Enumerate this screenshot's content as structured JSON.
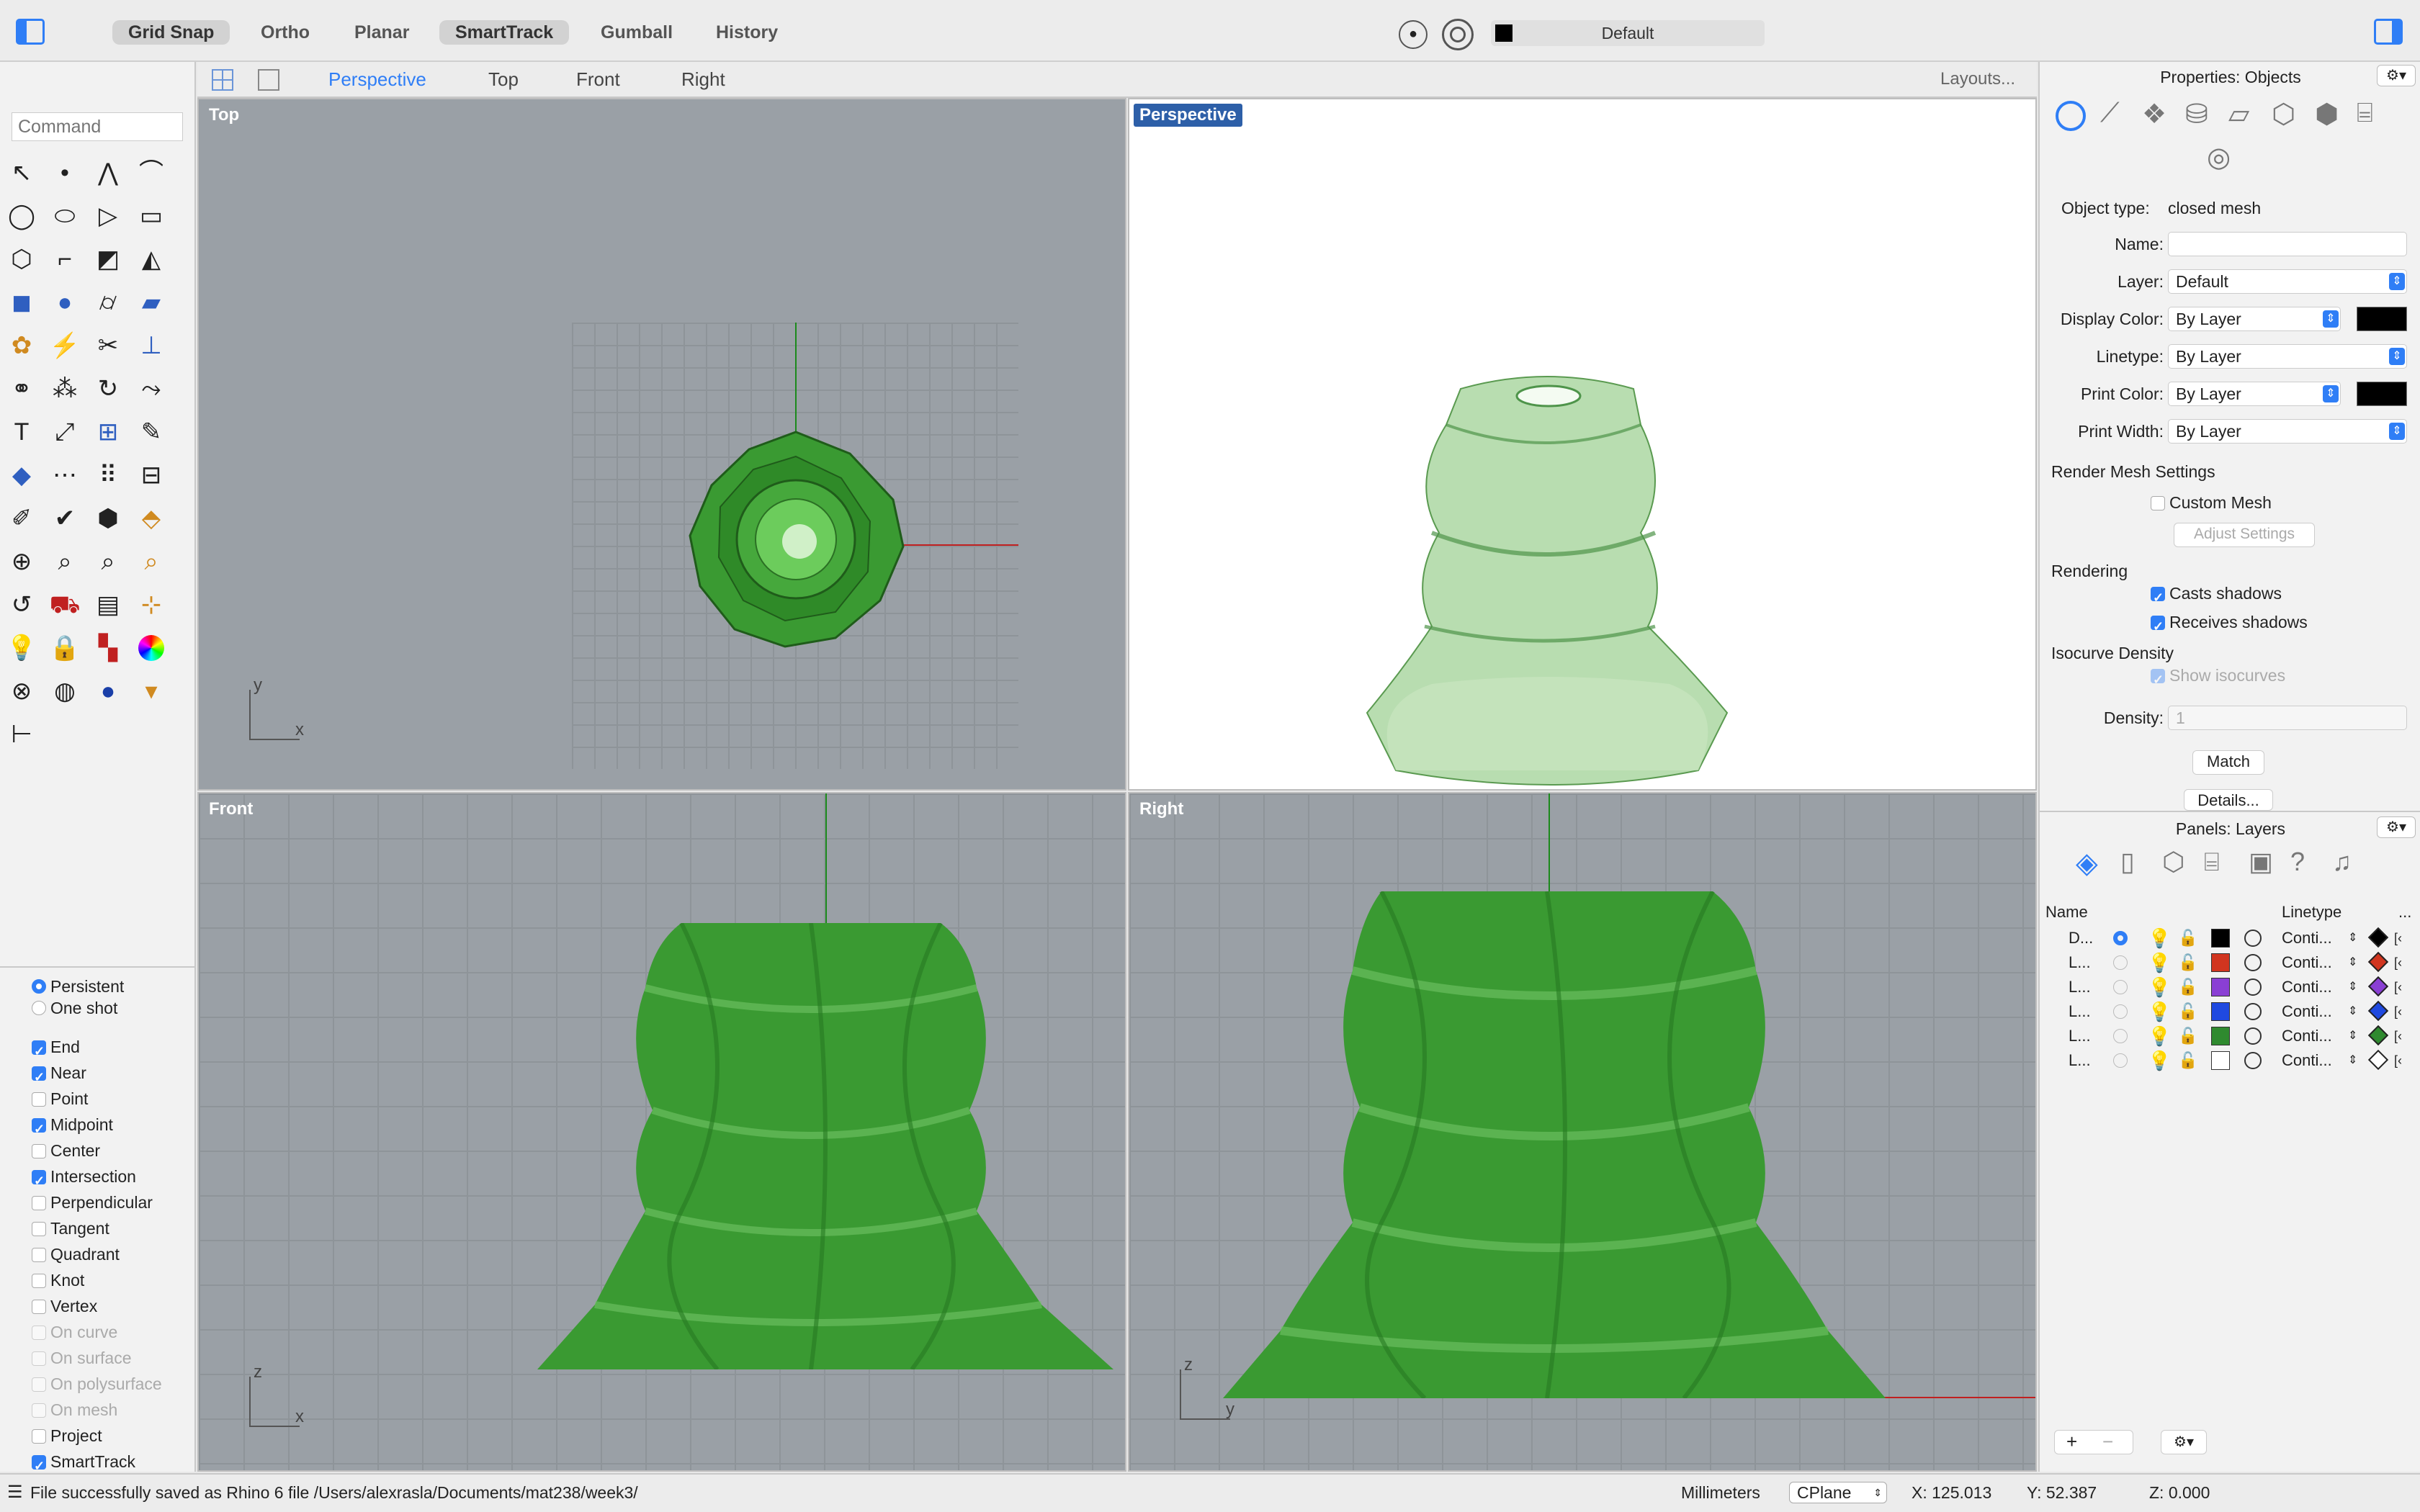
{
  "toolbar": {
    "buttons": [
      "Grid Snap",
      "Ortho",
      "Planar",
      "SmartTrack",
      "Gumball",
      "History"
    ],
    "layer_name": "Default"
  },
  "command": {
    "placeholder": "Command"
  },
  "view_tabs": {
    "perspective": "Perspective",
    "top": "Top",
    "front": "Front",
    "right": "Right",
    "layouts": "Layouts..."
  },
  "viewports": {
    "top": {
      "label": "Top",
      "axis_v": "y",
      "axis_h": "x"
    },
    "perspective": {
      "label": "Perspective"
    },
    "front": {
      "label": "Front",
      "axis_v": "z",
      "axis_h": "x"
    },
    "right": {
      "label": "Right",
      "axis_v": "z",
      "axis_h": "y"
    }
  },
  "snap_mode": {
    "persistent": "Persistent",
    "one_shot": "One shot"
  },
  "osnaps": [
    {
      "label": "End",
      "checked": true,
      "enabled": true
    },
    {
      "label": "Near",
      "checked": true,
      "enabled": true
    },
    {
      "label": "Point",
      "checked": false,
      "enabled": true
    },
    {
      "label": "Midpoint",
      "checked": true,
      "enabled": true
    },
    {
      "label": "Center",
      "checked": false,
      "enabled": true
    },
    {
      "label": "Intersection",
      "checked": true,
      "enabled": true
    },
    {
      "label": "Perpendicular",
      "checked": false,
      "enabled": true
    },
    {
      "label": "Tangent",
      "checked": false,
      "enabled": true
    },
    {
      "label": "Quadrant",
      "checked": false,
      "enabled": true
    },
    {
      "label": "Knot",
      "checked": false,
      "enabled": true
    },
    {
      "label": "Vertex",
      "checked": false,
      "enabled": true
    },
    {
      "label": "On curve",
      "checked": false,
      "enabled": false
    },
    {
      "label": "On surface",
      "checked": false,
      "enabled": false
    },
    {
      "label": "On polysurface",
      "checked": false,
      "enabled": false
    },
    {
      "label": "On mesh",
      "checked": false,
      "enabled": false
    },
    {
      "label": "Project",
      "checked": false,
      "enabled": true
    },
    {
      "label": "SmartTrack",
      "checked": true,
      "enabled": true
    }
  ],
  "properties": {
    "title": "Properties: Objects",
    "object_type_label": "Object type:",
    "object_type": "closed mesh",
    "name_label": "Name:",
    "layer_label": "Layer:",
    "layer": "Default",
    "display_color_label": "Display Color:",
    "display_color": "By Layer",
    "linetype_label": "Linetype:",
    "linetype": "By Layer",
    "print_color_label": "Print Color:",
    "print_color": "By Layer",
    "print_width_label": "Print Width:",
    "print_width": "By Layer",
    "render_mesh": "Render Mesh Settings",
    "custom_mesh": "Custom Mesh",
    "adjust": "Adjust Settings",
    "rendering": "Rendering",
    "casts": "Casts shadows",
    "receives": "Receives shadows",
    "isocurve": "Isocurve Density",
    "show_iso": "Show isocurves",
    "density_label": "Density:",
    "density": "1",
    "match": "Match",
    "details": "Details..."
  },
  "layers": {
    "title": "Panels: Layers",
    "col_name": "Name",
    "col_linetype": "Linetype",
    "col_more": "...",
    "rows": [
      {
        "name": "D...",
        "color": "#000000",
        "linetype": "Conti...",
        "current": true
      },
      {
        "name": "L...",
        "color": "#d1351f",
        "linetype": "Conti...",
        "current": false
      },
      {
        "name": "L...",
        "color": "#8a3fd4",
        "linetype": "Conti...",
        "current": false
      },
      {
        "name": "L...",
        "color": "#1f49e0",
        "linetype": "Conti...",
        "current": false
      },
      {
        "name": "L...",
        "color": "#2f8a2f",
        "linetype": "Conti...",
        "current": false
      },
      {
        "name": "L...",
        "color": "#ffffff",
        "linetype": "Conti...",
        "current": false
      }
    ]
  },
  "status": {
    "message": "File successfully saved as Rhino 6 file /Users/alexrasla/Documents/mat238/week3/",
    "units": "Millimeters",
    "cplane": "CPlane",
    "x": "X: 125.013",
    "y": "Y: 52.387",
    "z": "Z: 0.000"
  },
  "colors": {
    "accent": "#2f7ef6",
    "mesh_green": "#3a9a32",
    "perspective_label_bg": "#2d5fa8"
  }
}
